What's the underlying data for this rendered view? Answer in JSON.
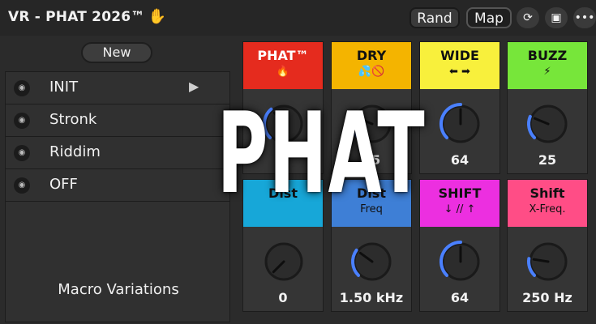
{
  "header": {
    "title": "VR - PHAT 2026™",
    "buttons": {
      "rand": "Rand",
      "map": "Map"
    },
    "icons": [
      "hand-icon",
      "refresh-icon",
      "save-icon",
      "more-icon"
    ]
  },
  "left": {
    "new_label": "New",
    "items": [
      {
        "label": "INIT",
        "icon": "camera-icon"
      },
      {
        "label": "Stronk",
        "icon": "camera-icon"
      },
      {
        "label": "Riddim",
        "icon": "camera-icon"
      },
      {
        "label": "OFF",
        "icon": "camera-icon"
      }
    ],
    "macro_label": "Macro Variations"
  },
  "macros": [
    {
      "label": "PHAT™",
      "sub": "🔥",
      "value": "",
      "color": "#e52b1e",
      "text_color": "#ffffff",
      "level": 0.35
    },
    {
      "label": "DRY",
      "sub": "💦🚫",
      "value": "25",
      "color": "#f4b400",
      "text_color": "#111111",
      "level": 0.25
    },
    {
      "label": "WIDE",
      "sub": "⬅ ➡",
      "value": "64",
      "color": "#f8f03c",
      "text_color": "#111111",
      "level": 0.5
    },
    {
      "label": "BUZZ",
      "sub": "⚡",
      "value": "25",
      "color": "#77e63a",
      "text_color": "#111111",
      "level": 0.25
    },
    {
      "label": "Dist",
      "sub": "",
      "value": "0",
      "color": "#17a7d8",
      "text_color": "#111111",
      "level": 0.0
    },
    {
      "label": "Dist",
      "sub": "Freq",
      "value": "1.50 kHz",
      "color": "#3e7fd6",
      "text_color": "#111111",
      "level": 0.3
    },
    {
      "label": "SHIFT",
      "sub": "↓ // ↑",
      "value": "64",
      "color": "#ec2fe0",
      "text_color": "#111111",
      "level": 0.5
    },
    {
      "label": "Shift",
      "sub": "X-Freq.",
      "value": "250 Hz",
      "color": "#ff4d86",
      "text_color": "#111111",
      "level": 0.2
    }
  ],
  "overlay_text": "PHAT",
  "colors": {
    "knob_arc": "#4a80ff",
    "knob_body": "#1a1a1a"
  }
}
